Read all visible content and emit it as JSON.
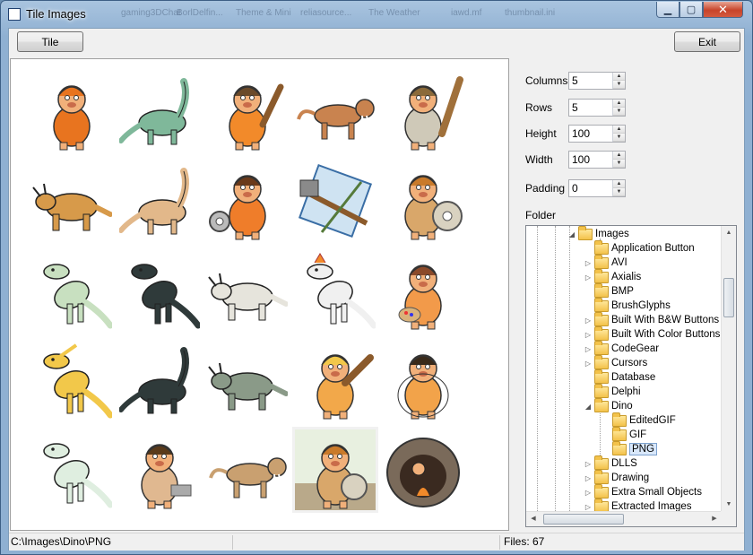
{
  "window": {
    "title": "Tile Images"
  },
  "taskbar_ghost": [
    "gaming3DChat",
    "BorlDelfin...",
    "Theme & Mini",
    "reliasource...",
    "The Weather",
    "iawd.mf",
    "thumbnail.ini"
  ],
  "toolbar": {
    "tile_label": "Tile",
    "exit_label": "Exit"
  },
  "settings": {
    "columns": {
      "label": "Columns",
      "value": "5"
    },
    "rows": {
      "label": "Rows",
      "value": "5"
    },
    "height": {
      "label": "Height",
      "value": "100"
    },
    "width": {
      "label": "Width",
      "value": "100"
    },
    "padding": {
      "label": "Padding",
      "value": "0"
    },
    "folder_label": "Folder"
  },
  "tree": {
    "items": [
      {
        "label": "Images",
        "expanded": true
      },
      {
        "label": "Application Button"
      },
      {
        "label": "AVI"
      },
      {
        "label": "Axialis"
      },
      {
        "label": "BMP"
      },
      {
        "label": "BrushGlyphs"
      },
      {
        "label": "Built With B&W Buttons"
      },
      {
        "label": "Built With Color Buttons"
      },
      {
        "label": "CodeGear"
      },
      {
        "label": "Cursors"
      },
      {
        "label": "Database"
      },
      {
        "label": "Delphi"
      },
      {
        "label": "Dino",
        "expanded": true
      },
      {
        "label": "EditedGIF"
      },
      {
        "label": "GIF"
      },
      {
        "label": "PNG",
        "selected": true
      },
      {
        "label": "DLLS"
      },
      {
        "label": "Drawing"
      },
      {
        "label": "Extra Small Objects"
      },
      {
        "label": "Extracted Images"
      }
    ]
  },
  "tiles": [
    "caveman-hairy-icon",
    "brachiosaurus-icon",
    "caveman-club-icon",
    "sabertooth-icon",
    "caveman-laughing-icon",
    "triceratops-icon",
    "long-neck-dino-icon",
    "caveman-wheel-icon",
    "cave-tools-icon",
    "caveman-stone-wheel-icon",
    "trex-green-icon",
    "trex-striped-icon",
    "white-dino-icon",
    "white-crested-dino-icon",
    "caveman-painter-icon",
    "parasaurolophus-icon",
    "sauropod-black-icon",
    "triceratops-grey-icon",
    "caveman-blonde-icon",
    "caveman-fat-icon",
    "raptor-green-icon",
    "caveman-writing-icon",
    "sabertooth-walking-icon",
    "caveman-grinding-icon",
    "cave-fire-icon"
  ],
  "colors": {
    "skin": "#f1b07a",
    "fur": "#e8741f",
    "dino_green": "#7fb89a",
    "dino_dark": "#2f3a3a",
    "bone": "#d9d2c0"
  },
  "status": {
    "path": "C:\\Images\\Dino\\PNG",
    "files": "Files: 67"
  }
}
